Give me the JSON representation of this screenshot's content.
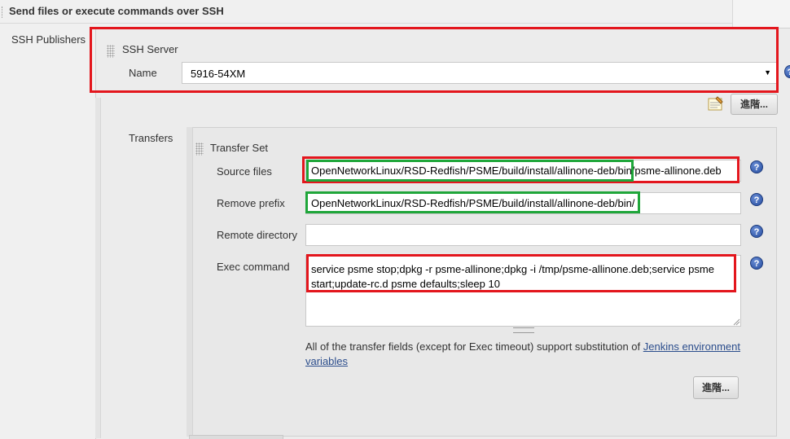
{
  "section": {
    "title": "Send files or execute commands over SSH"
  },
  "publishers": {
    "label": "SSH Publishers"
  },
  "ssh_server": {
    "heading": "SSH Server",
    "name_label": "Name",
    "name_value": "5916-54XM",
    "advanced_label": "進階..."
  },
  "transfers": {
    "label": "Transfers",
    "set_heading": "Transfer Set",
    "source_files_label": "Source files",
    "source_files_value": "OpenNetworkLinux/RSD-Redfish/PSME/build/install/allinone-deb/bin/psme-allinone.deb",
    "remove_prefix_label": "Remove prefix",
    "remove_prefix_value": "OpenNetworkLinux/RSD-Redfish/PSME/build/install/allinone-deb/bin/",
    "remote_directory_label": "Remote directory",
    "remote_directory_value": "",
    "exec_command_label": "Exec command",
    "exec_command_value": "service psme stop;dpkg -r psme-allinone;dpkg -i /tmp/psme-allinone.deb;service psme start;update-rc.d psme defaults;sleep 10",
    "note_text": "All of the transfer fields (except for Exec timeout) support substitution of ",
    "note_link": "Jenkins environment variables",
    "advanced_label": "進階..."
  },
  "help_icon_glyph": "?",
  "colors": {
    "highlight_red": "#e3161d",
    "highlight_green": "#1fa63a",
    "help_blue": "#244b9e"
  }
}
